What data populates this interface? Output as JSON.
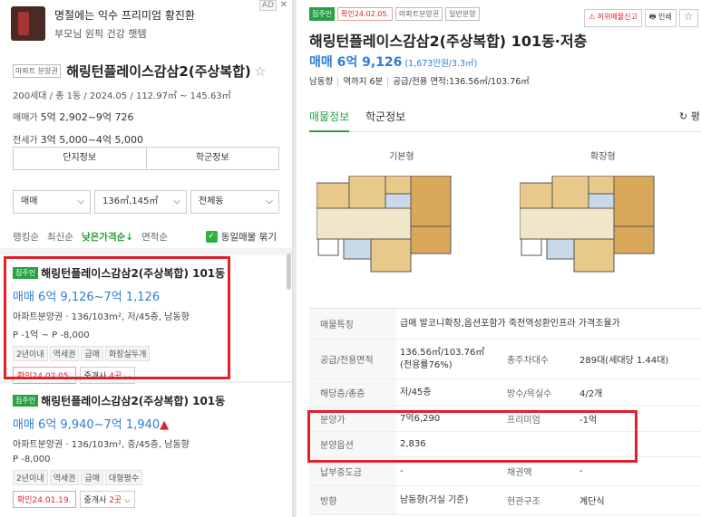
{
  "ad": {
    "line1": "명절에는 익수 프리미엄 황진환",
    "line2": "부모님 원픽 건강 햇템",
    "tag": "AD",
    "close": "✕"
  },
  "summary": {
    "type_tag": "마파트 분양권",
    "name": "해링턴플레이스감삼2(주상복합)",
    "meta": "200세대 / 총 1동 / 2024.05 / 112.97㎡ ~ 145.63㎡",
    "sale_label": "매매가",
    "sale_value": "5억 2,902~9억 726",
    "jeonse_label": "전세가",
    "jeonse_value": "3억 5,000~4억 5,000"
  },
  "buttons": {
    "complex": "단지정보",
    "school": "학군정보"
  },
  "filters": {
    "trade": "매매",
    "area": "136㎡,145㎡",
    "dong": "전체동"
  },
  "sort": {
    "items": [
      "랭킹순",
      "최신순",
      "낮은가격순↓",
      "면적순"
    ],
    "active": 2,
    "group_label": "동일매물 묶기"
  },
  "listings": [
    {
      "badge": "집주인",
      "name": "해링턴플레이스감삼2(주상복합) 101동",
      "price": "매매 6억 9,126~7억 1,126",
      "price_up": "",
      "desc": "아파트분양권 · 136/103m², 저/45층, 남동향",
      "premium": "P -1억 ~ P -8,000",
      "keywords": [
        "2년이내",
        "역세권",
        "급매",
        "화장실두개"
      ],
      "confirm": "확인24.02.05.",
      "agent_prefix": "중개사 ",
      "agent_count": "4곳"
    },
    {
      "badge": "집주인",
      "name": "해링턴플레이스감삼2(주상복합) 101동",
      "price": "매매 6억 9,940~7억 1,940",
      "price_up": "▲",
      "desc": "아파트분양권 · 136/103m², 중/45층, 남동향",
      "premium": "P -8,000",
      "keywords": [
        "2년이내",
        "역세권",
        "급매",
        "대형평수"
      ],
      "confirm": "확인24.01.19.",
      "agent_prefix": "중개사 ",
      "agent_count": "2곳"
    }
  ],
  "detail": {
    "badge": "집주인",
    "confirm": "확인24.02.05.",
    "tag1": "마파트분양권",
    "tag2": "일반분양",
    "report": "허위매물신고",
    "print": "인쇄",
    "star": "☆",
    "title": "해링턴플레이스감삼2(주상복합) 101동·저층",
    "price": "매매 6억 9,126",
    "price_unit": "(1,673만원/3.3㎡)",
    "meta": [
      "남동향",
      "역까지 6분",
      "공급/전용 면적:136.56㎡/103.76㎡"
    ],
    "tabs": [
      "매물정보",
      "학군정보"
    ],
    "tab_right": "평",
    "plan_basic": "기본형",
    "plan_ext": "확장형",
    "rows": [
      {
        "k": "매물특징",
        "v": "급매 발코니확장,옵션포함가 죽전역성환인프라 가격조율가",
        "k2": "",
        "v2": ""
      },
      {
        "k": "공급/전용면적",
        "v": "136.56㎡/103.76㎡ (전용률76%)",
        "k2": "총주차대수",
        "v2": "289대(세대당 1.44대)"
      },
      {
        "k": "해당층/총층",
        "v": "저/45층",
        "k2": "방수/욕실수",
        "v2": "4/2개"
      },
      {
        "k": "분양가",
        "v": "7억6,290",
        "k2": "프리미엄",
        "v2": "-1억"
      },
      {
        "k": "분양옵션",
        "v": "2,836",
        "k2": "",
        "v2": ""
      },
      {
        "k": "납부중도금",
        "v": "-",
        "k2": "채권액",
        "v2": "-"
      },
      {
        "k": "방향",
        "v": "남동향(거실 기준)",
        "k2": "현관구조",
        "v2": "계단식"
      }
    ]
  },
  "colors": {
    "green": "#26a144",
    "blue": "#2d7ed9",
    "red": "#e0202a"
  }
}
